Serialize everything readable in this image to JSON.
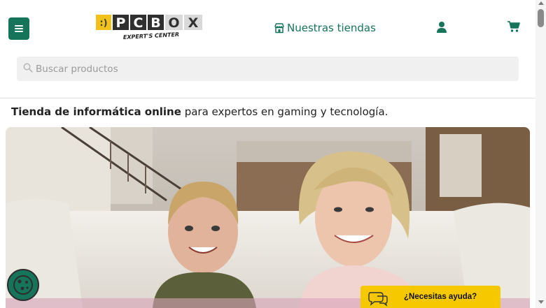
{
  "header": {
    "menu_icon": "hamburger-menu-icon",
    "logo": {
      "brand": "PCBOX",
      "tagline": "EXPERT'S CENTER"
    },
    "stores_link": "Nuestras tiendas",
    "stores_icon": "store-icon",
    "user_icon": "user-icon",
    "cart_icon": "shopping-cart-icon",
    "accent_color": "#16745a"
  },
  "search": {
    "placeholder": "Buscar productos",
    "icon": "search-icon"
  },
  "intro": {
    "bold": "Tienda de informática online",
    "rest": " para expertos en gaming y tecnología."
  },
  "hero": {
    "alt": "Madre e hijo sonriendo en un sofá"
  },
  "cookie_button": {
    "icon": "cookie-icon"
  },
  "help": {
    "label": "¿Necesitas ayuda?",
    "icon": "chat-bubbles-icon",
    "color": "#f6c800"
  }
}
